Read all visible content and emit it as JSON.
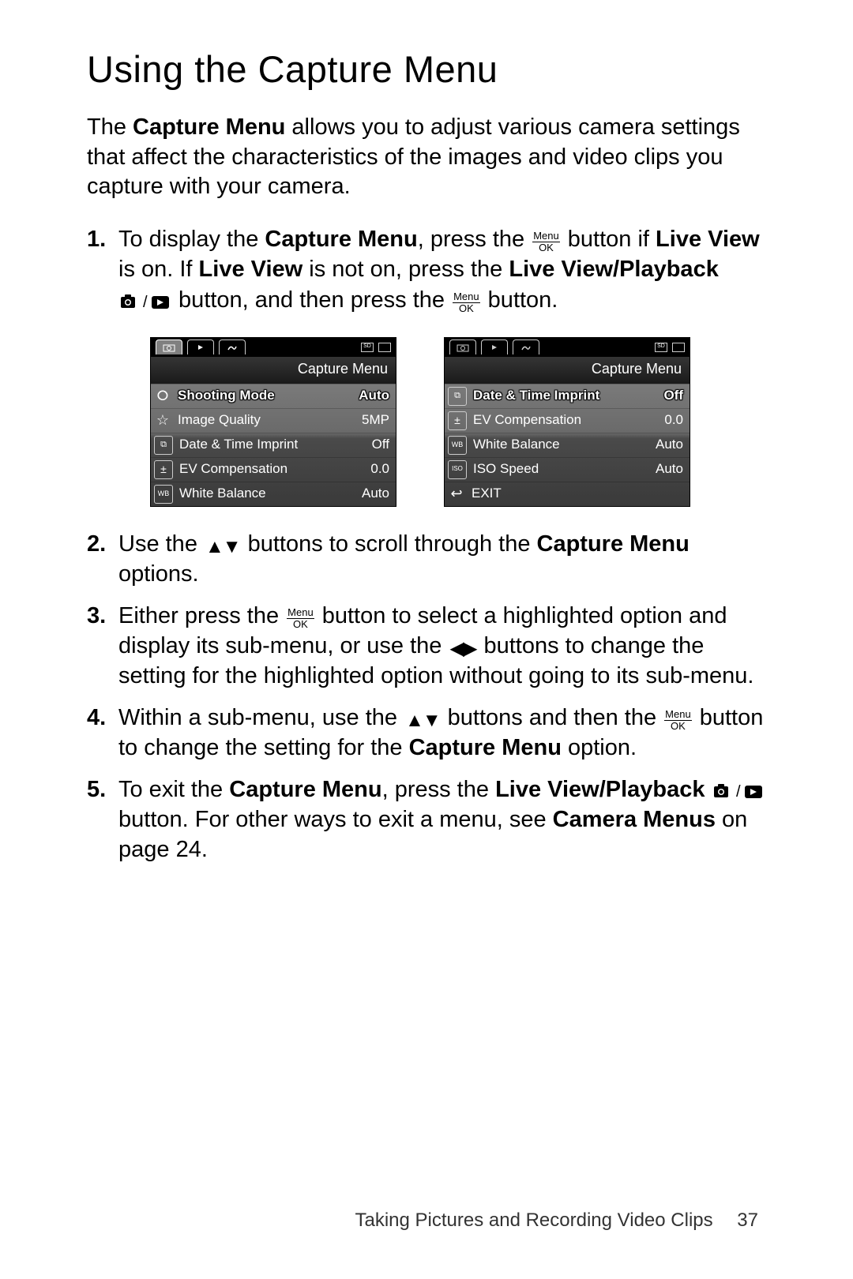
{
  "heading": "Using the Capture Menu",
  "intro": {
    "pre": "The ",
    "bold1": "Capture Menu",
    "post": " allows you to adjust various camera settings that affect the characteristics of the images and video clips you capture with your camera."
  },
  "menu_ok": {
    "top": "Menu",
    "bottom": "OK"
  },
  "steps": {
    "s1": {
      "a": "To display the ",
      "b": "Capture Menu",
      "c": ", press the ",
      "d": " button if ",
      "e": "Live View",
      "f": " is on. If ",
      "g": "Live View",
      "h": " is not on, press the ",
      "i": "Live View/Playback",
      "j": " button, and then press the ",
      "k": " button."
    },
    "s2": {
      "a": "Use the ",
      "b": " buttons to scroll through the ",
      "c": "Capture Menu",
      "d": " options."
    },
    "s3": {
      "a": "Either press the ",
      "b": " button to select a highlighted option and display its sub-menu, or use the ",
      "c": " buttons to change the setting for the highlighted option without going to its sub-menu."
    },
    "s4": {
      "a": "Within a sub-menu, use the ",
      "b": " buttons and then the ",
      "c": " button to change the setting for the ",
      "d": "Capture Menu",
      "e": " option."
    },
    "s5": {
      "a": "To exit the ",
      "b": "Capture Menu",
      "c": ", press the ",
      "d": "Live View/Playback",
      "e": " button. For other ways to exit a menu, see ",
      "f": "Camera Menus",
      "g": " on page 24."
    }
  },
  "screen_title": "Capture Menu",
  "screen1": {
    "rows": [
      {
        "icon": "⭘",
        "label": "Shooting Mode",
        "value": "Auto",
        "hl": true
      },
      {
        "icon": "☆",
        "label": "Image Quality",
        "value": "5MP",
        "hl": false
      },
      {
        "icon": "⧉",
        "label": "Date & Time Imprint",
        "value": "Off",
        "hl": false
      },
      {
        "icon": "±",
        "label": "EV Compensation",
        "value": "0.0",
        "hl": false
      },
      {
        "icon": "WB",
        "label": "White Balance",
        "value": "Auto",
        "hl": false
      }
    ]
  },
  "screen2": {
    "rows": [
      {
        "icon": "⧉",
        "label": "Date & Time Imprint",
        "value": "Off",
        "hl": true
      },
      {
        "icon": "±",
        "label": "EV Compensation",
        "value": "0.0",
        "hl": false
      },
      {
        "icon": "WB",
        "label": "White Balance",
        "value": "Auto",
        "hl": false
      },
      {
        "icon": "ISO",
        "label": "ISO Speed",
        "value": "Auto",
        "hl": false
      },
      {
        "icon": "↩",
        "label": "EXIT",
        "value": "",
        "hl": false
      }
    ]
  },
  "footer": {
    "chapter": "Taking Pictures and Recording Video Clips",
    "page": "37"
  }
}
